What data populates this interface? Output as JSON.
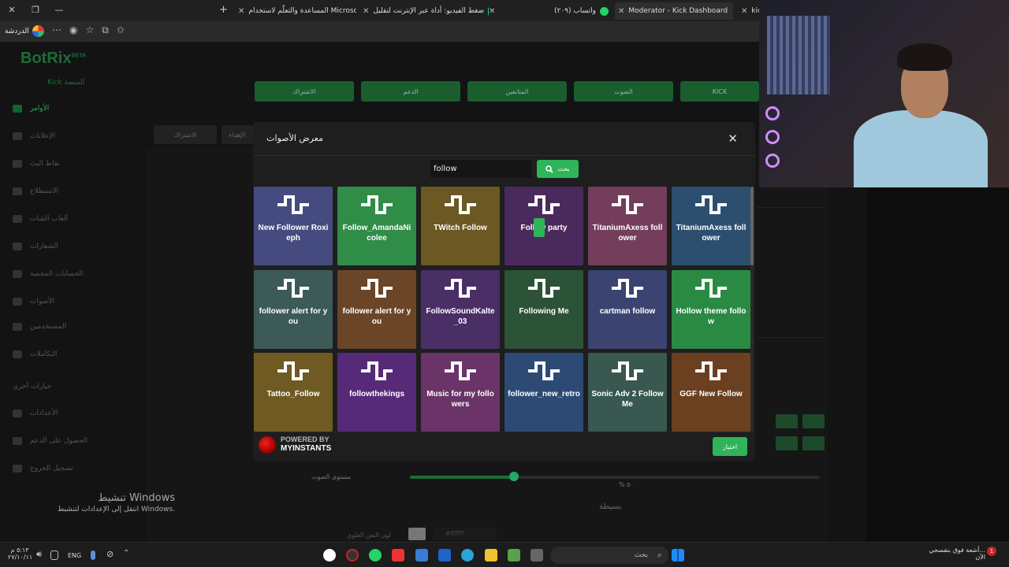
{
  "browser": {
    "tabs": [
      {
        "title": "kick",
        "color": "#53fc18"
      },
      {
        "title": "Moderator - Kick Dashboard",
        "color": "#53fc18"
      },
      {
        "title": "(٢٠٩) واتساب",
        "color": "#25d366"
      },
      {
        "title": "ضغط الفيديو: أداة عبر الإنترنت لتقليل",
        "color": "#17c964"
      },
      {
        "title": "المساعدة والتعلّم لاستخدام Microsoft Edge",
        "color": "#f25022"
      }
    ],
    "profile_label": "الدردشة",
    "new_tab_icon": "plus-icon"
  },
  "background": {
    "brand": "BotRix",
    "brand_tag": "BETA",
    "brand_sub": "Kick المنصة",
    "nav": [
      "الأوامر",
      "الإعلانات",
      "نقاط البث",
      "الاستطلاع",
      "ألعاب الشات",
      "الشعارات",
      "الحسابات المحمية",
      "الأصوات",
      "المستخدمين",
      "التكاملات",
      "خيارات أخرى",
      "الأعدادات",
      "الحصول على الدعم",
      "تسجيل الخروج"
    ],
    "top_buttons": [
      "KICK",
      "الصوت",
      "المتابعين",
      "الدعم",
      "الاشتراك"
    ],
    "tabs": [
      "الاشتراك",
      "الإهداء"
    ],
    "volume_label": "مستوى الصوت",
    "volume_value": "% ٥٠",
    "section_label": "بسيطة",
    "color_label": "لون النص العلوي",
    "color_value": "#ffffff"
  },
  "windows_activation": {
    "title": "تنشيط Windows",
    "subtitle": "انتقل إلى الإعدادات لتنشيط Windows."
  },
  "modal": {
    "title": "معرض الأصوات",
    "search_value": "follow",
    "search_button": "بحث",
    "powered_by": "POWERED BY",
    "powered_brand": "MYINSTANTS",
    "choose_button": "اختيار",
    "sounds": [
      {
        "label": "New Follower Roxieph",
        "color": "#454b7e"
      },
      {
        "label": "Follow_AmandaNicolee",
        "color": "#2f8d47"
      },
      {
        "label": "TWitch Follow",
        "color": "#6b5823"
      },
      {
        "label": "Follow party",
        "color": "#4a2a5c"
      },
      {
        "label": "TitaniumAxess follower",
        "color": "#743d5b"
      },
      {
        "label": "TitaniumAxess follower",
        "color": "#2c4f70"
      },
      {
        "label": "follower alert for you",
        "color": "#3b5a58"
      },
      {
        "label": "follower alert for you",
        "color": "#6b4528"
      },
      {
        "label": "FollowSoundKalte_03",
        "color": "#4a2e66"
      },
      {
        "label": "Following Me",
        "color": "#2c5238"
      },
      {
        "label": "cartman follow",
        "color": "#3b4470"
      },
      {
        "label": "Hollow theme follow",
        "color": "#2a8a44"
      },
      {
        "label": "Tattoo_Follow",
        "color": "#6e5a22"
      },
      {
        "label": "followthekings",
        "color": "#562a78"
      },
      {
        "label": "Music for my followers",
        "color": "#6a3468"
      },
      {
        "label": "follower_new_retro",
        "color": "#2d4a75"
      },
      {
        "label": "Sonic Adv 2 Follow Me",
        "color": "#385850"
      },
      {
        "label": "GGF New Follow",
        "color": "#6a4020"
      }
    ]
  },
  "taskbar": {
    "search_placeholder": "بحث",
    "language": "ENG",
    "time": "٥:١٣ م",
    "date": "٢٧/١٠/١١",
    "notification": "أشعة فوق بنفسجي...",
    "notification_sub": "الآن",
    "notification_count": "1"
  }
}
